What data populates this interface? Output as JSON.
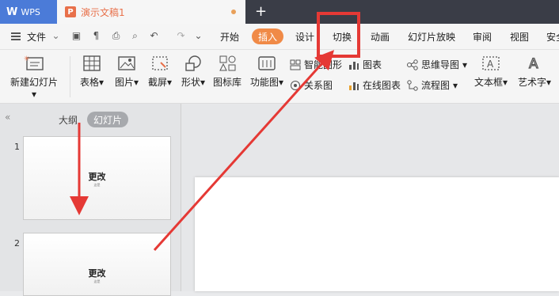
{
  "titlebar": {
    "app_name": "WPS",
    "doc_title": "演示文稿1",
    "new_tab": "+"
  },
  "menubar": {
    "file": "文件",
    "tabs": [
      "开始",
      "插入",
      "设计",
      "切换",
      "动画",
      "幻灯片放映",
      "审阅",
      "视图",
      "安全"
    ],
    "active_tab": "插入",
    "highlighted_tab": "切换"
  },
  "ribbon": {
    "new_slide": "新建幻灯片",
    "table": "表格",
    "picture": "图片",
    "screenshot": "截屏",
    "shape": "形状",
    "icon_lib": "图标库",
    "function_chart": "功能图",
    "smart_graphic": "智能图形",
    "relation_chart": "关系图",
    "chart": "图表",
    "online_chart": "在线图表",
    "mind_map": "思维导图",
    "flow_chart": "流程图",
    "textbox": "文本框",
    "wordart": "艺术字"
  },
  "panel": {
    "outline_tab": "大纲",
    "slides_tab": "幻灯片",
    "slides": [
      {
        "number": "1",
        "title": "更改",
        "subtitle": "这是"
      },
      {
        "number": "2",
        "title": "更改",
        "subtitle": "这是"
      }
    ]
  },
  "colors": {
    "accent": "#f08a47",
    "annotation": "#e53935",
    "wps_blue": "#4b7bd8"
  }
}
